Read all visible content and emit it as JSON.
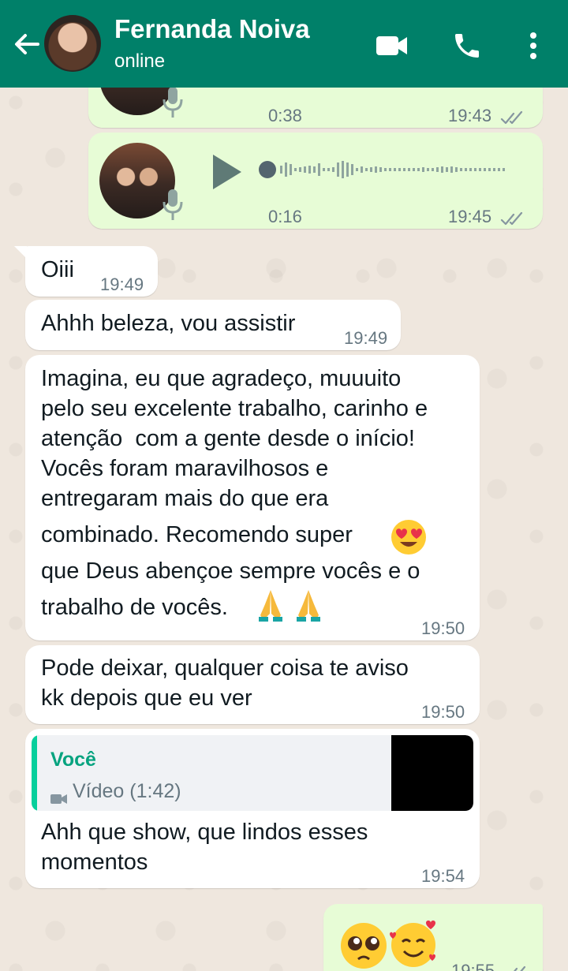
{
  "header": {
    "contact_name": "Fernanda Noiva",
    "status": "online"
  },
  "messages": [
    {
      "type": "voice",
      "duration": "0:38",
      "time": "19:43"
    },
    {
      "type": "voice",
      "duration": "0:16",
      "time": "19:45"
    },
    {
      "type": "text",
      "text": "Oiii",
      "time": "19:49"
    },
    {
      "type": "text",
      "text": "Ahhh beleza, vou assistir",
      "time": "19:49"
    },
    {
      "type": "text",
      "lines": [
        "Imagina, eu que agradeço, muuuito",
        "pelo seu excelente trabalho, carinho e",
        "atenção  com a gente desde o início!",
        "Vocês foram maravilhosos e",
        "entregaram mais do que era",
        "combinado. Recomendo super",
        "que Deus abençoe sempre vocês e o",
        "trabalho de vocês."
      ],
      "time": "19:50"
    },
    {
      "type": "text",
      "lines": [
        "Pode deixar, qualquer coisa te aviso",
        "kk depois que eu ver"
      ],
      "time": "19:50"
    },
    {
      "type": "reply",
      "quote_author": "Você",
      "quote_text": "Vídeo (1:42)",
      "lines": [
        "Ahh que show, que lindos esses",
        "momentos"
      ],
      "time": "19:54"
    },
    {
      "type": "emoji",
      "time": "19:55"
    }
  ],
  "colors": {
    "header": "#008069",
    "outgoing": "#e7fcd6",
    "incoming": "#ffffff",
    "read_ticks": "#53bdeb",
    "quote_accent": "#06cf9c"
  },
  "icons": [
    "back-arrow-icon",
    "video-call-icon",
    "phone-icon",
    "menu-dots-icon",
    "microphone-icon",
    "play-icon",
    "double-check-icon",
    "video-camera-icon"
  ]
}
